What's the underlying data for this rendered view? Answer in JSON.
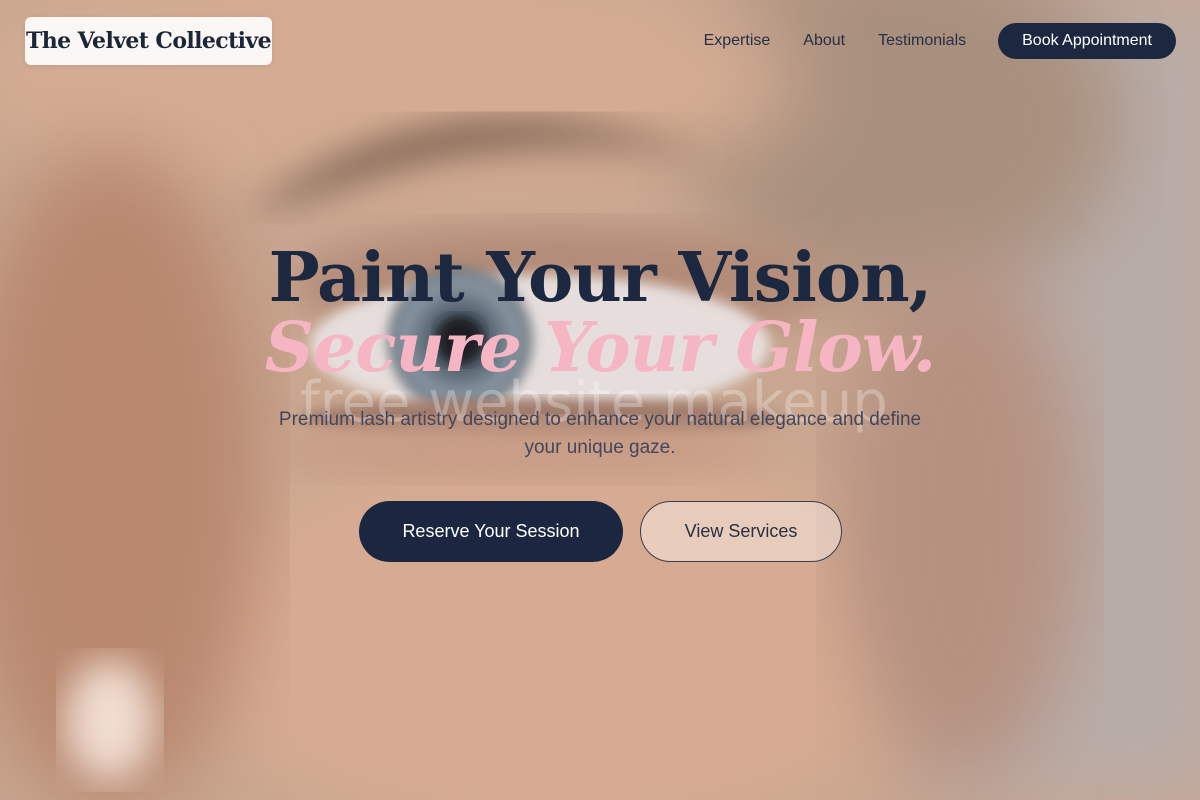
{
  "brand": {
    "name": "The Velvet Collective"
  },
  "nav": {
    "items": [
      {
        "label": "Expertise"
      },
      {
        "label": "About"
      },
      {
        "label": "Testimonials"
      }
    ],
    "cta_label": "Book Appointment"
  },
  "hero": {
    "headline_line1": "Paint Your Vision,",
    "headline_line2": "Secure Your Glow.",
    "watermark": "free website makeup",
    "subtitle": "Premium lash artistry designed to enhance your natural elegance and define your unique gaze.",
    "primary_cta": "Reserve Your Session",
    "secondary_cta": "View Services"
  },
  "colors": {
    "navy": "#1c2840",
    "pink_accent": "#f6b5c3",
    "skin_tone": "#c9a58e"
  }
}
